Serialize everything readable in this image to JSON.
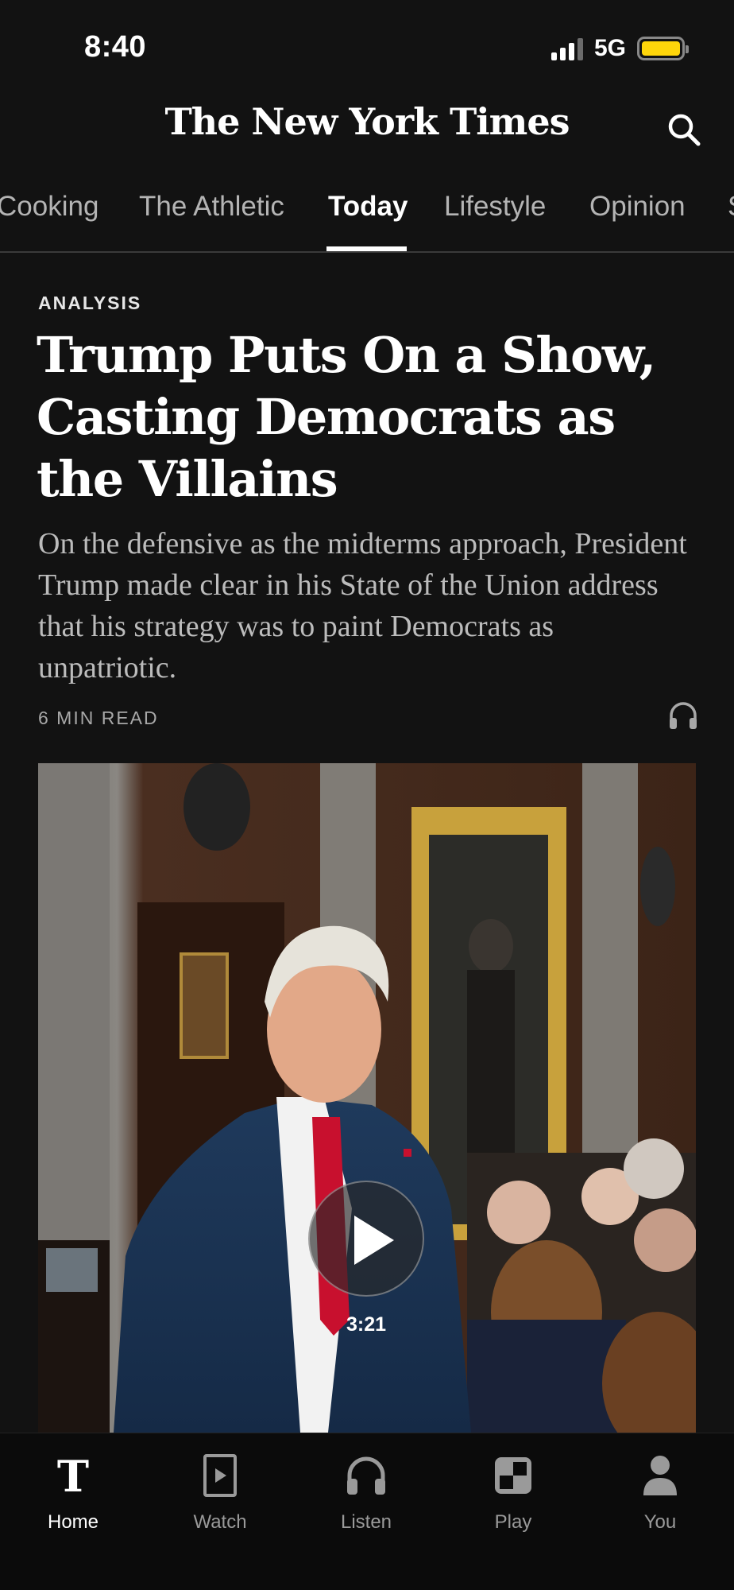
{
  "status_bar": {
    "time": "8:40",
    "network": "5G"
  },
  "masthead": {
    "logo": "The New York Times"
  },
  "tabs": [
    {
      "label": "Cooking",
      "active": false
    },
    {
      "label": "The Athletic",
      "active": false
    },
    {
      "label": "Today",
      "active": true
    },
    {
      "label": "Lifestyle",
      "active": false
    },
    {
      "label": "Opinion",
      "active": false
    },
    {
      "label": "S",
      "active": false
    }
  ],
  "article": {
    "kicker": "ANALYSIS",
    "headline": "Trump Puts On a Show, Casting Democrats as the Villains",
    "summary": "On the defensive as the midterms approach, President Trump made clear in his State of the Union address that his strategy was to paint Democrats as unpatriotic.",
    "read_time": "6 MIN READ",
    "video_duration": "3:21"
  },
  "bottom_nav": [
    {
      "label": "Home",
      "icon": "nyt-t-icon",
      "active": true
    },
    {
      "label": "Watch",
      "icon": "watch-icon",
      "active": false
    },
    {
      "label": "Listen",
      "icon": "headphones-icon",
      "active": false
    },
    {
      "label": "Play",
      "icon": "play-grid-icon",
      "active": false
    },
    {
      "label": "You",
      "icon": "person-icon",
      "active": false
    }
  ],
  "colors": {
    "background": "#121212",
    "battery": "#ffd60a",
    "muted_text": "#bcbcbc"
  }
}
